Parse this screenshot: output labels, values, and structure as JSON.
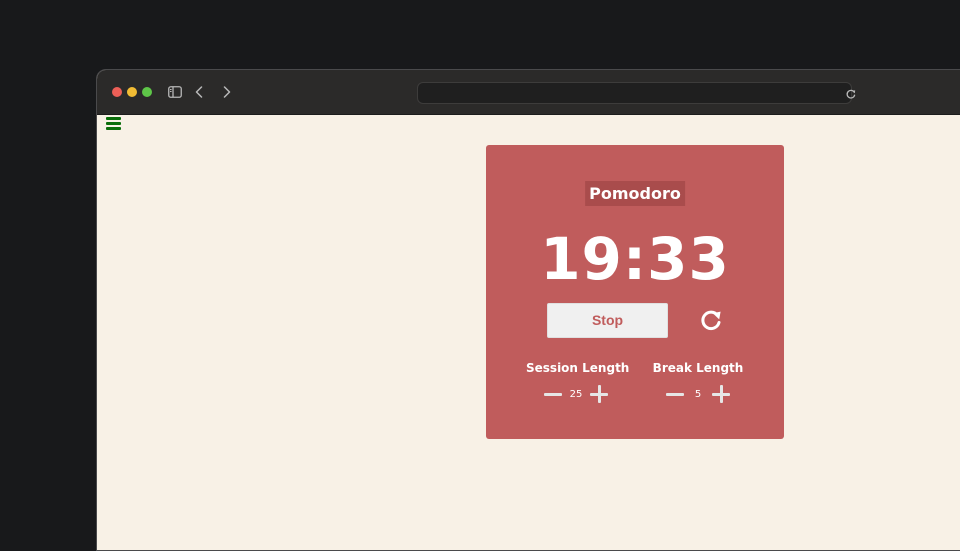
{
  "browser": {
    "address": "",
    "icons": {
      "sidebar": "sidebar-toggle-icon",
      "back": "chevron-left-icon",
      "forward": "chevron-right-icon",
      "reload": "reload-icon"
    }
  },
  "app": {
    "menu_icon": "hamburger-menu-icon",
    "title": "Pomodoro",
    "time": "19:33",
    "stop_label": "Stop",
    "reset_icon": "reset-icon",
    "session": {
      "label": "Session Length",
      "value": "25"
    },
    "break": {
      "label": "Break Length",
      "value": "5"
    }
  },
  "colors": {
    "page_background": "#f8f1e6",
    "card": "#c05c5c",
    "title_highlight": "#a94c4c",
    "menu_icon": "#0b6e0b",
    "stop_button_bg": "#f0f0f0"
  }
}
